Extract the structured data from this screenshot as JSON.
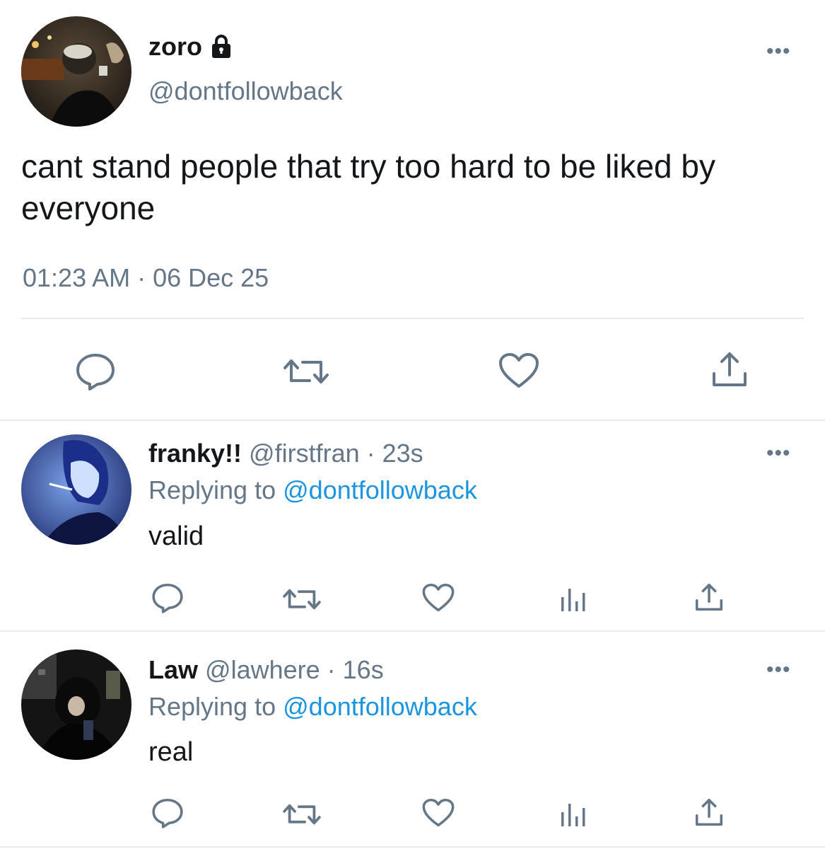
{
  "main_tweet": {
    "display_name": "zoro",
    "handle": "@dontfollowback",
    "text": "cant stand people that try too hard to be liked by everyone",
    "timestamp": "01:23 AM · 06 Dec 25",
    "avatar_icon": "avatar-photo-man-night",
    "lock_icon": "lock-icon"
  },
  "replies": [
    {
      "display_name": "franky!!",
      "handle": "@firstfran",
      "time": "· 23s",
      "replying_label": "Replying to",
      "replying_to": "@dontfollowback",
      "text": "valid"
    },
    {
      "display_name": "Law",
      "handle": "@lawhere",
      "time": "· 16s",
      "replying_label": "Replying to",
      "replying_to": "@dontfollowback",
      "text": "real"
    }
  ],
  "colors": {
    "text": "#14171a",
    "muted": "#657786",
    "link": "#1b95e0",
    "divider": "#e6ecf0"
  }
}
